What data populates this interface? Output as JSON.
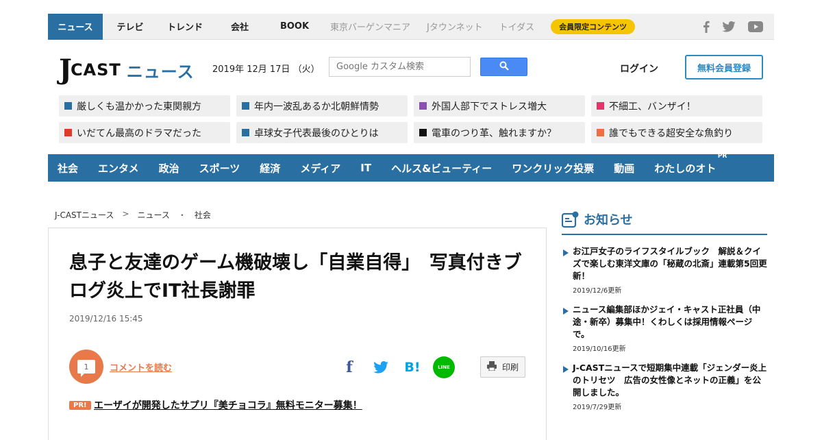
{
  "topbar": {
    "tabs": [
      "ニュース",
      "テレビ",
      "トレンド",
      "会社",
      "BOOK"
    ],
    "sublinks": [
      "東京バーゲンマニア",
      "Jタウンネット",
      "トイダス"
    ],
    "member_label": "会員限定コンテンツ",
    "social_icons": [
      "facebook-icon",
      "twitter-icon",
      "youtube-icon"
    ]
  },
  "header": {
    "logo_j": "J",
    "logo_cast": "CAST",
    "logo_news": "ニュース",
    "date": "2019年 12月 17日 （火）",
    "search_placeholder": "Google カスタム検索",
    "login_label": "ログイン",
    "register_label": "無料会員登録"
  },
  "topics": [
    {
      "label": "厳しくも温かかった東関親方",
      "color": "#2a6fa1"
    },
    {
      "label": "年内一波乱あるか北朝鮮情勢",
      "color": "#2a6fa1"
    },
    {
      "label": "外国人部下でストレス増大",
      "color": "#8a4fb0"
    },
    {
      "label": "不細工、バンザイ！",
      "color": "#e8336a"
    },
    {
      "label": "いだてん最高のドラマだった",
      "color": "#e03a2a"
    },
    {
      "label": "卓球女子代表最後のひとりは",
      "color": "#2a6fa1"
    },
    {
      "label": "電車のつり革、触れますか？",
      "color": "#111111"
    },
    {
      "label": "誰でもできる超安全な魚釣り",
      "color": "#ee7040"
    }
  ],
  "categories": [
    "社会",
    "エンタメ",
    "政治",
    "スポーツ",
    "経済",
    "メディア",
    "IT",
    "ヘルス&ビューティー",
    "ワンクリック投票",
    "動画",
    "わたしのオト"
  ],
  "category_pr_badge": "PR",
  "breadcrumb": {
    "items": [
      "J-CASTニュース",
      "ニュース",
      "社会"
    ],
    "separators": [
      ">",
      "・"
    ]
  },
  "article": {
    "title": "息子と友達のゲーム機破壊し「自業自得」　写真付きブログ炎上でIT社長謝罪",
    "published": "2019/12/16 15:45",
    "comment_count": "1",
    "comment_label": "コメントを読む",
    "share_fb": "f",
    "share_hb": "B!",
    "share_line": "LINE",
    "print_label": "印刷",
    "pr_badge": "PR!",
    "pr_text": "エーザイが開発したサプリ『美チョコラ』無料モニター募集！"
  },
  "sidebar": {
    "title": "お知らせ",
    "notices": [
      {
        "text": "お江戸女子のライフスタイルブック　解説＆クイズで楽しむ東洋文庫の「秘蔵の北斎」連載第5回更新！",
        "date": "2019/12/6更新"
      },
      {
        "text": "ニュース編集部ほかジェイ・キャスト正社員（中途・新卒）募集中！くわしくは採用情報ページで。",
        "date": "2019/10/16更新"
      },
      {
        "text": "J-CASTニュースで短期集中連載「ジェンダー炎上のトリセツ　広告の女性像とネットの正義」を公開しました。",
        "date": "2019/7/29更新"
      }
    ]
  },
  "colors": {
    "brand_blue": "#2a6fa1",
    "accent_orange": "#e8794a",
    "member_yellow": "#f5c600"
  }
}
